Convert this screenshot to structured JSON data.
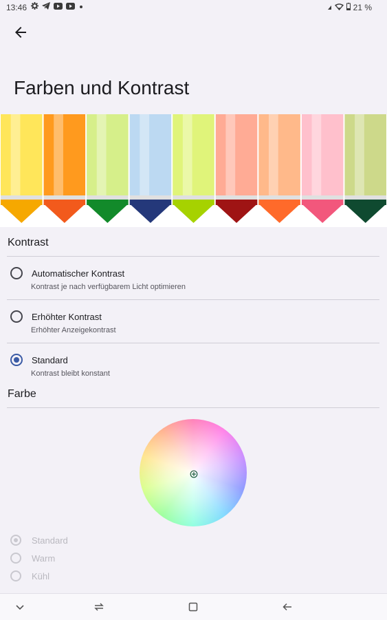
{
  "status_bar": {
    "time": "13:46",
    "left_icons": [
      "settings-icon",
      "telegram-icon",
      "youtube-icon",
      "youtube-icon",
      "dot-icon"
    ],
    "battery_text": "21 %"
  },
  "header": {
    "back_icon": "arrow-left-icon",
    "title": "Farben und Kontrast"
  },
  "banner": {
    "pencil_colors": [
      {
        "body": "#ffe65a",
        "tip": "#f6a800"
      },
      {
        "body": "#ff9a1e",
        "tip": "#f25a1c"
      },
      {
        "body": "#d6ef8a",
        "tip": "#128a2a"
      },
      {
        "body": "#bcd9f2",
        "tip": "#24387a"
      },
      {
        "body": "#e0f47a",
        "tip": "#a6d200"
      },
      {
        "body": "#ffab95",
        "tip": "#9f1414"
      },
      {
        "body": "#ffb98a",
        "tip": "#ff6a2a"
      },
      {
        "body": "#ffc0cc",
        "tip": "#f2577c"
      },
      {
        "body": "#cdd98a",
        "tip": "#0f4a30"
      }
    ]
  },
  "contrast": {
    "header": "Kontrast",
    "options": [
      {
        "title": "Automatischer Kontrast",
        "subtitle": "Kontrast je nach verfügbarem Licht optimieren",
        "selected": false
      },
      {
        "title": "Erhöhter Kontrast",
        "subtitle": "Erhöhter Anzeigekontrast",
        "selected": false
      },
      {
        "title": "Standard",
        "subtitle": "Kontrast bleibt konstant",
        "selected": true
      }
    ]
  },
  "color": {
    "header": "Farbe",
    "options": [
      {
        "label": "Standard",
        "selected": true
      },
      {
        "label": "Warm",
        "selected": false
      },
      {
        "label": "Kühl",
        "selected": false
      }
    ]
  },
  "accent_color": "#3a5aa5",
  "nav_bar": {
    "icons": [
      "chevron-down-icon",
      "recent-apps-icon",
      "home-icon",
      "back-icon"
    ]
  }
}
